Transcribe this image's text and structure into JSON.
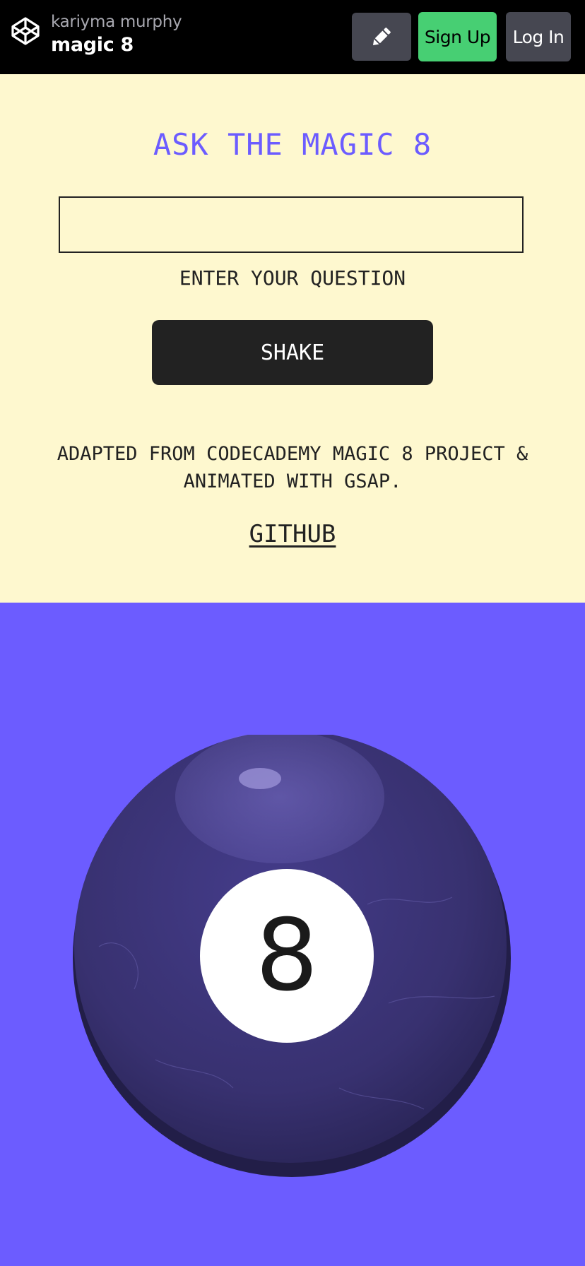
{
  "header": {
    "logo_icon": "codepen-logo-icon",
    "user_name": "kariyma murphy",
    "pen_title": "magic 8",
    "edit_icon": "pencil-icon",
    "signup_label": "Sign Up",
    "login_label": "Log In",
    "colors": {
      "bar": "#000000",
      "signup": "#47cf73",
      "button": "#464751"
    }
  },
  "main": {
    "heading": "ASK THE MAGIC 8",
    "question_input": {
      "value": "",
      "placeholder": ""
    },
    "input_label": "ENTER YOUR QUESTION",
    "shake_label": "SHAKE",
    "credit_line1": "ADAPTED FROM CODECADEMY MAGIC 8 PROJECT &",
    "credit_line2": "ANIMATED WITH GSAP.",
    "github_label": "GITHUB",
    "colors": {
      "panel": "#fef8cf",
      "accent": "#6c5cff",
      "text": "#222222"
    }
  },
  "ball": {
    "number": "8",
    "colors": {
      "background": "#6c5cff",
      "ball": "#3a3478",
      "window": "#ffffff"
    }
  }
}
